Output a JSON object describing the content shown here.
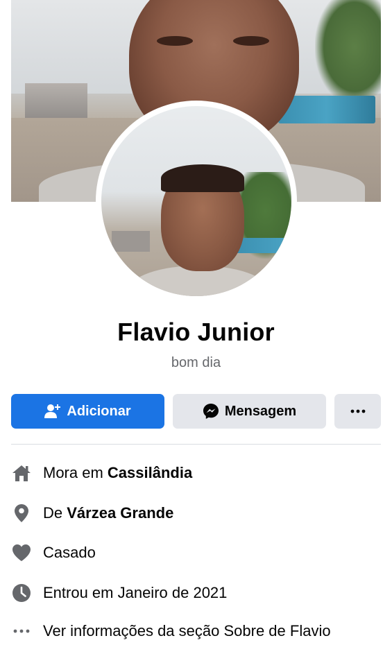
{
  "profile": {
    "name": "Flavio Junior",
    "bio": "bom dia"
  },
  "actions": {
    "add_label": "Adicionar",
    "message_label": "Mensagem",
    "more_label": "···"
  },
  "details": [
    {
      "icon": "home-icon",
      "prefix": "Mora em ",
      "value": "Cassilândia"
    },
    {
      "icon": "location-pin-icon",
      "prefix": "De ",
      "value": "Várzea Grande"
    },
    {
      "icon": "heart-icon",
      "prefix": "Casado",
      "value": ""
    },
    {
      "icon": "clock-icon",
      "prefix": "Entrou em Janeiro de 2021",
      "value": ""
    },
    {
      "icon": "more-dots-icon",
      "prefix": "Ver informações da seção Sobre de Flavio",
      "value": ""
    }
  ],
  "colors": {
    "primary": "#1b74e4",
    "secondary_button": "#e4e6eb",
    "icon_gray": "#65676b",
    "muted_text": "#65676b"
  }
}
